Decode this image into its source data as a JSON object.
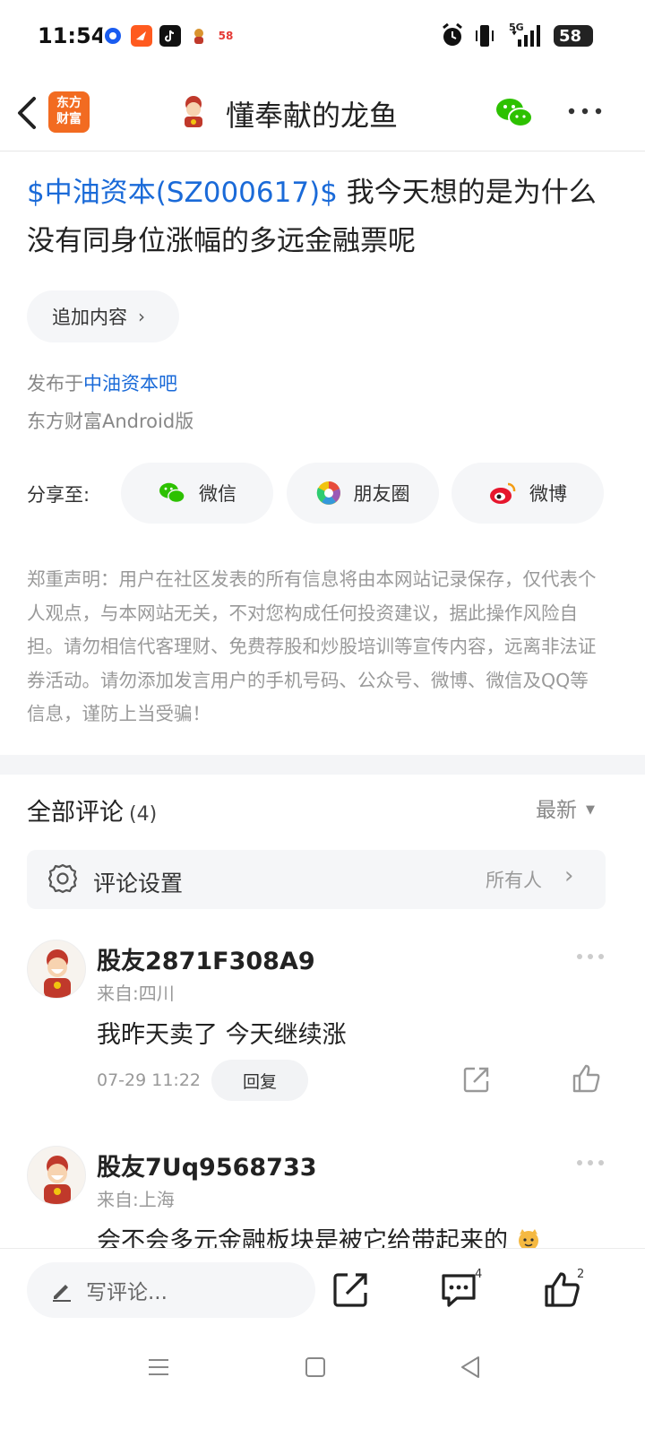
{
  "status_bar": {
    "time": "11:54",
    "app_icons": [
      "browser-icon",
      "feishu-icon",
      "tiktok-icon",
      "game-icon",
      "58-icon"
    ],
    "app_icon_58_label": "58",
    "battery": "58",
    "network": "5G"
  },
  "nav": {
    "logo_text": "东方财富",
    "title": "懂奉献的龙鱼"
  },
  "post": {
    "stock_link": "$中油资本(SZ000617)$",
    "text": " 我今天想的是为什么没有同身位涨幅的多远金融票呢",
    "add_content_label": "追加内容",
    "published_prefix": "发布于",
    "published_bar": "中油资本吧",
    "client": "东方财富Android版"
  },
  "share": {
    "label": "分享至:",
    "items": [
      "微信",
      "朋友圈",
      "微博"
    ]
  },
  "disclaimer": "郑重声明：用户在社区发表的所有信息将由本网站记录保存，仅代表个人观点，与本网站无关，不对您构成任何投资建议，据此操作风险自担。请勿相信代客理财、免费荐股和炒股培训等宣传内容，远离非法证券活动。请勿添加发言用户的手机号码、公众号、微博、微信及QQ等信息，谨防上当受骗！",
  "comments": {
    "title": "全部评论",
    "count": "(4)",
    "sort_label": "最新",
    "settings_label": "评论设置",
    "settings_value": "所有人",
    "items": [
      {
        "name": "股友2871F308A9",
        "location": "来自:四川",
        "body": "我昨天卖了 今天继续涨",
        "time": "07-29 11:22",
        "reply_label": "回复"
      },
      {
        "name": "股友7Uq9568733",
        "location": "来自:上海",
        "body": "会不会多元金融板块是被它给带起来的"
      }
    ]
  },
  "bottom_bar": {
    "write_placeholder": "写评论...",
    "comment_count": "4",
    "like_count": "2"
  },
  "colors": {
    "link": "#1a6ad8",
    "brand_orange": "#f26b21",
    "wechat_green": "#2dc100",
    "weibo_red": "#e6162d"
  }
}
